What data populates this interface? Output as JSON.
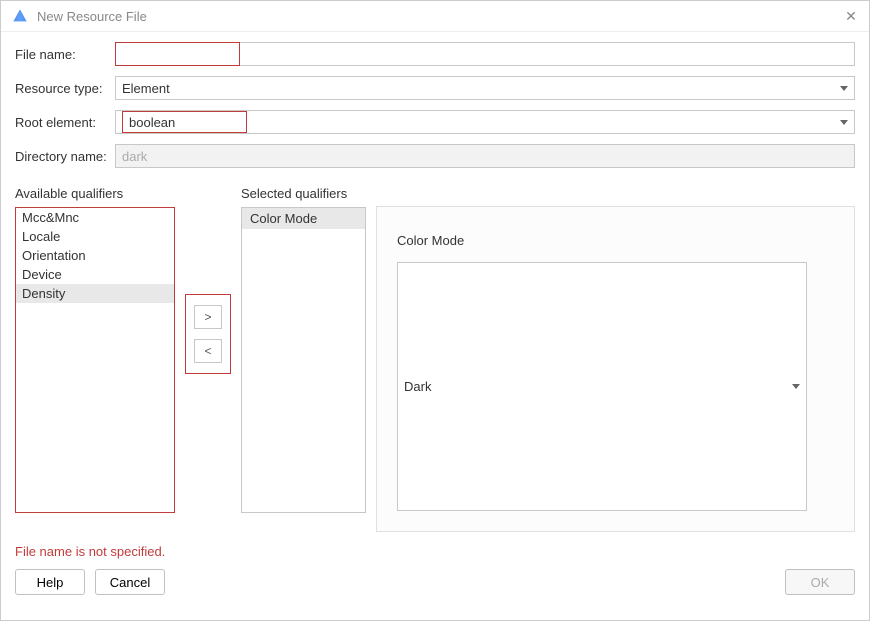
{
  "titlebar": {
    "title": "New Resource File"
  },
  "form": {
    "file_name_label": "File name:",
    "file_name_value": "",
    "resource_type_label": "Resource type:",
    "resource_type_value": "Element",
    "root_element_label": "Root element:",
    "root_element_value": "boolean",
    "directory_name_label": "Directory name:",
    "directory_name_value": "dark"
  },
  "qualifiers": {
    "available_header": "Available qualifiers",
    "selected_header": "Selected qualifiers",
    "available": [
      "Mcc&Mnc",
      "Locale",
      "Orientation",
      "Device",
      "Density"
    ],
    "available_selected_index": 4,
    "selected": [
      "Color Mode"
    ],
    "move_right_label": ">",
    "move_left_label": "<"
  },
  "details": {
    "label": "Color Mode",
    "value": "Dark"
  },
  "error": "File name is not specified.",
  "footer": {
    "help": "Help",
    "cancel": "Cancel",
    "ok": "OK"
  }
}
